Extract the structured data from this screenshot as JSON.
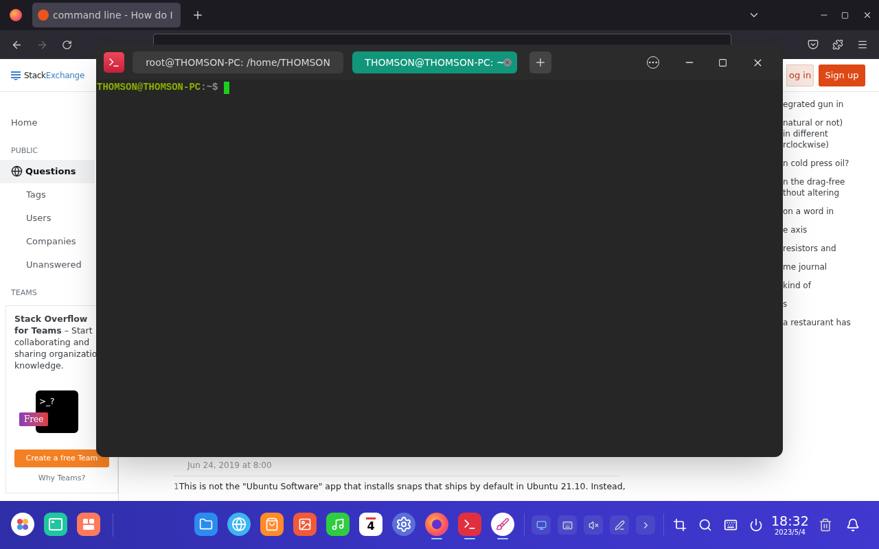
{
  "browser": {
    "tabs": [
      {
        "title": "command line - How do I",
        "selected": true
      }
    ]
  },
  "site": {
    "logo_a": "Stack",
    "logo_b": "Exchange",
    "login": "og in",
    "signup": "Sign up"
  },
  "sidebar": {
    "items": [
      {
        "kind": "link",
        "label": "Home",
        "selected": false
      },
      {
        "kind": "heading",
        "label": "PUBLIC"
      },
      {
        "kind": "link",
        "label": "Questions",
        "selected": true
      },
      {
        "kind": "sublink",
        "label": "Tags",
        "selected": false
      },
      {
        "kind": "sublink",
        "label": "Users",
        "selected": false
      },
      {
        "kind": "sublink",
        "label": "Companies",
        "selected": false
      },
      {
        "kind": "sublink",
        "label": "Unanswered",
        "selected": false
      },
      {
        "kind": "heading",
        "label": "TEAMS"
      }
    ]
  },
  "teams_card": {
    "text": "**Stack Overflow for Teams** – Start collaborating and sharing organizatio knowledge.",
    "prompt": ">_?",
    "badge": "Free",
    "button": "Create a free Team",
    "link": "Why Teams?"
  },
  "hot_questions": [
    "egrated gun in",
    "natural or not)\nin different\nrclockwise)",
    "n cold press oil?",
    "n the drag-free\nthout altering",
    "on a word in",
    "e axis",
    "resistors and",
    "me journal",
    "kind of",
    "s",
    "a restaurant has"
  ],
  "comments": {
    "date": "Jun 24, 2019 at 8:00",
    "score": "1",
    "text": "This is not the \"Ubuntu Software\" app that installs snaps that ships by default in Ubuntu 21.10. Instead,"
  },
  "terminal": {
    "tabs": [
      {
        "title": "root@THOMSON-PC: /home/THOMSON",
        "selected": false
      },
      {
        "title": "THOMSON@THOMSON-PC: ~",
        "selected": true
      }
    ],
    "prompt_user": "THOMSON@THOMSON-PC",
    "prompt_path": ":~$"
  },
  "dock": {
    "apps": [
      {
        "kind": "launcher",
        "running": false
      },
      {
        "kind": "multitask",
        "running": false
      },
      {
        "kind": "widgets",
        "running": false
      },
      {
        "kind": "files",
        "running": false
      },
      {
        "kind": "browser",
        "running": false
      },
      {
        "kind": "store",
        "running": false
      },
      {
        "kind": "photos",
        "running": false
      },
      {
        "kind": "music",
        "running": false
      },
      {
        "kind": "calendar",
        "running": false
      },
      {
        "kind": "settings",
        "running": false
      },
      {
        "kind": "firefox",
        "running": true
      },
      {
        "kind": "terminal",
        "running": true
      },
      {
        "kind": "draw",
        "running": true
      }
    ],
    "calendar_day": "4",
    "time": "18:32",
    "date": "2023/5/4"
  }
}
